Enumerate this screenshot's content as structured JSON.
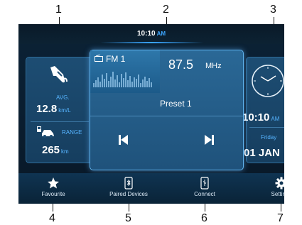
{
  "callouts": [
    "1",
    "2",
    "3",
    "4",
    "5",
    "6",
    "7"
  ],
  "status": {
    "time": "10:10",
    "ampm": "AM"
  },
  "left_panel": {
    "avg_label": "AVG.",
    "avg_value": "12.8",
    "avg_unit": "km/L",
    "range_label": "RANGE",
    "range_value": "265",
    "range_unit": "km"
  },
  "center_panel": {
    "band": "FM 1",
    "frequency": "87.5",
    "freq_unit": "MHz",
    "preset": "Preset 1"
  },
  "right_panel": {
    "time": "10:10",
    "ampm": "AM",
    "weekday": "Friday",
    "date": "01 JAN"
  },
  "bottom_bar": {
    "favourite": "Favourite",
    "paired": "Paired Devices",
    "connect": "Connect",
    "settings": "Settings"
  },
  "colors": {
    "accent": "#3ea7ff",
    "panel": "#1d4d73",
    "screen": "#0b2236"
  }
}
